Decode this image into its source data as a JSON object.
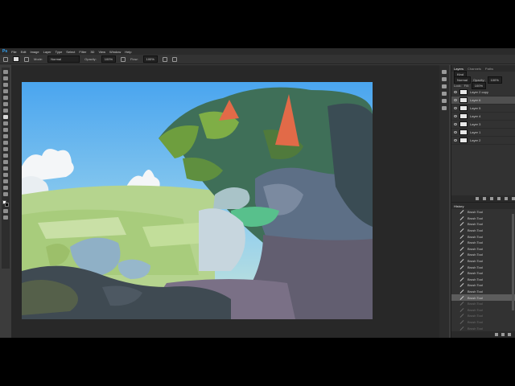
{
  "app": {
    "logo": "Ps"
  },
  "menu": [
    "File",
    "Edit",
    "Image",
    "Layer",
    "Type",
    "Select",
    "Filter",
    "3D",
    "View",
    "Window",
    "Help"
  ],
  "options": {
    "mode_label": "Mode:",
    "mode_value": "Normal",
    "opacity_label": "Opacity:",
    "opacity_value": "100%",
    "flow_label": "Flow:",
    "flow_value": "100%"
  },
  "layers_panel": {
    "tabs": [
      "Layers",
      "Channels",
      "Paths"
    ],
    "kind_value": "Kind",
    "blend_value": "Normal",
    "opacity_label": "Opacity:",
    "opacity_value": "100%",
    "lock_label": "Lock:",
    "fill_label": "Fill:",
    "fill_value": "100%",
    "layers": [
      "Layer 2 copy",
      "Layer 6",
      "Layer 5",
      "Layer 4",
      "Layer 3",
      "Layer 1",
      "Layer 2"
    ],
    "selected_index": 1
  },
  "history_panel": {
    "title": "History",
    "items": [
      "Brush Tool",
      "Brush Tool",
      "Brush Tool",
      "Brush Tool",
      "Brush Tool",
      "Brush Tool",
      "Brush Tool",
      "Brush Tool",
      "Brush Tool",
      "Brush Tool",
      "Brush Tool",
      "Brush Tool",
      "Brush Tool",
      "Brush Tool",
      "Brush Tool",
      "Brush Tool",
      "Brush Tool",
      "Brush Tool",
      "Brush Tool",
      "Brush Tool"
    ],
    "selected_index": 14
  }
}
